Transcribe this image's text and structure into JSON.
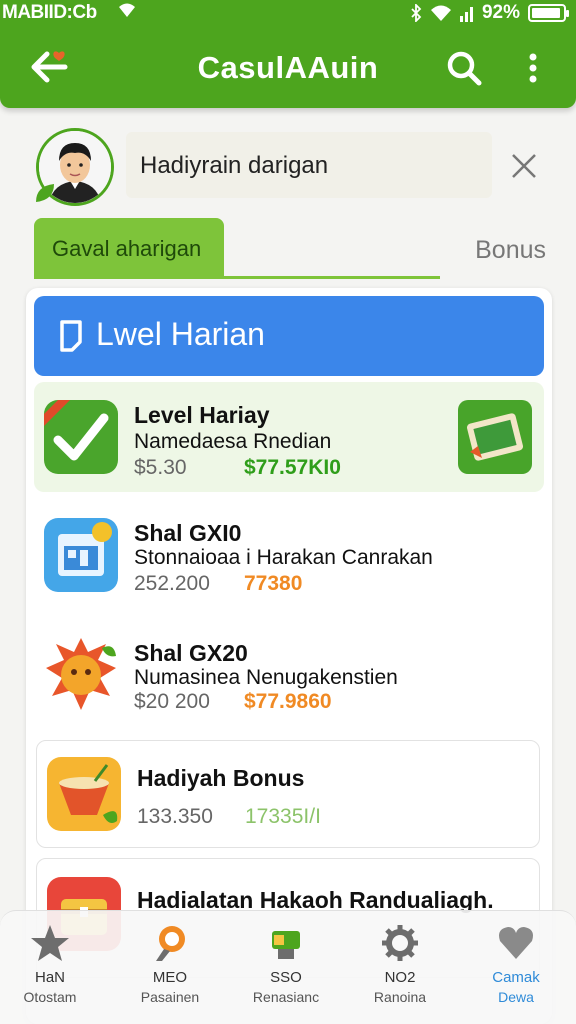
{
  "status_bar": {
    "carrier": "MABIID:Cb",
    "battery_text": "92%",
    "battery_level": 0.92
  },
  "app_bar": {
    "title": "CasulAAuin",
    "back_icon": "arrow-left-icon",
    "search_icon": "search-icon",
    "more_icon": "more-vertical-icon"
  },
  "profile": {
    "name": "Hadiyrain darigan",
    "close_icon": "close-icon"
  },
  "tabs": [
    {
      "label": "Gaval aharigan",
      "active": true
    },
    {
      "label": "Bonus",
      "active": false
    }
  ],
  "panel": {
    "header": "Lwel Harian"
  },
  "items": [
    {
      "title": "Level Hariay",
      "subtitle": "Namedaesa Rnedian",
      "price": "$5.30",
      "price2": "$77.57KI0",
      "price2_color": "#2f9e1a"
    },
    {
      "title": "Shal GXI0",
      "subtitle": "Stonnaioaa i Harakan Canrakan",
      "price": "252.200",
      "price2": "77380",
      "price2_color": "#f08a24"
    },
    {
      "title": "Shal GX20",
      "subtitle": "Numasinea Nenugakenstien",
      "price": "$20 200",
      "price2": "$77.9860",
      "price2_color": "#f08a24"
    },
    {
      "title": "Hadiyah Bonus",
      "subtitle": "",
      "price": "133.350",
      "price2": "17335I/I",
      "price2_color": "#8cc36a"
    },
    {
      "title": "Hadialatan Hakaoh Randualiagh.",
      "subtitle": "",
      "price": "",
      "price2": "",
      "price2_color": "#8cc36a"
    }
  ],
  "bottom_nav": [
    {
      "line1": "HaN",
      "line2": "Otostam",
      "icon": "star-icon",
      "active": false
    },
    {
      "line1": "MEO",
      "line2": "Pasainen",
      "icon": "medal-icon",
      "active": false
    },
    {
      "line1": "SSO",
      "line2": "Renasianc",
      "icon": "gift-icon",
      "active": false
    },
    {
      "line1": "NO2",
      "line2": "Ranoina",
      "icon": "gear-icon",
      "active": false
    },
    {
      "line1": "Camak",
      "line2": "Dewa",
      "icon": "heart-icon",
      "active": true
    }
  ],
  "colors": {
    "primary_green": "#4da51e",
    "light_green": "#7ec43a",
    "header_blue": "#3b86ea",
    "active_nav": "#2f8bd8"
  }
}
